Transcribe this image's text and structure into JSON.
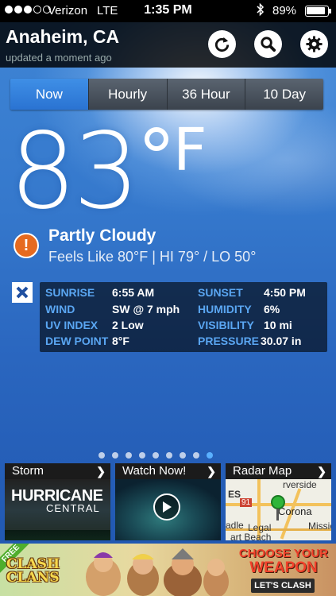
{
  "status_bar": {
    "carrier": "Verizon",
    "network": "LTE",
    "time": "1:35 PM",
    "battery": "89%",
    "battery_level": 0.89
  },
  "header": {
    "city": "Anaheim, CA",
    "updated": "updated a moment ago",
    "icons": [
      "refresh-icon",
      "search-icon",
      "gear-icon"
    ]
  },
  "tabs": [
    {
      "label": "Now",
      "active": true
    },
    {
      "label": "Hourly",
      "active": false
    },
    {
      "label": "36 Hour",
      "active": false
    },
    {
      "label": "10 Day",
      "active": false
    }
  ],
  "current": {
    "temperature": "83",
    "unit": "F",
    "condition": "Partly Cloudy",
    "feels_like": "Feels Like 80°F | HI 79° / LO 50°",
    "alert_icon": "!"
  },
  "details": [
    {
      "label": "SUNRISE",
      "value": "6:55 AM",
      "label2": "SUNSET",
      "value2": "4:50 PM"
    },
    {
      "label": "WIND",
      "value": "SW @ 7 mph",
      "label2": "HUMIDITY",
      "value2": "6%"
    },
    {
      "label": "UV INDEX",
      "value": "2 Low",
      "label2": "VISIBILITY",
      "value2": "10 mi"
    },
    {
      "label": "DEW POINT",
      "value": "8°F",
      "label2": "PRESSURE",
      "value2": "30.07 in"
    }
  ],
  "page_indicator": {
    "count": 9,
    "active_index": 8
  },
  "cards": {
    "storm": {
      "title": "Storm",
      "line1": "HURRICANE",
      "line2": "CENTRAL"
    },
    "watch": {
      "title": "Watch Now!"
    },
    "radar": {
      "title": "Radar Map",
      "labels": [
        "ES",
        "rverside",
        "Corona",
        "Mission",
        "adle",
        "Legal",
        "art Beach",
        "91"
      ]
    }
  },
  "ad": {
    "badge": "FREE",
    "logo_line1": "CLASH",
    "logo_line2": "CLANS",
    "headline_line1": "CHOOSE YOUR",
    "headline_line2": "WEAPON",
    "button": "LET'S CLASH"
  },
  "colors": {
    "accent": "#2a73d2",
    "label_blue": "#5aa6f2",
    "alert_orange": "#e66a1f"
  }
}
